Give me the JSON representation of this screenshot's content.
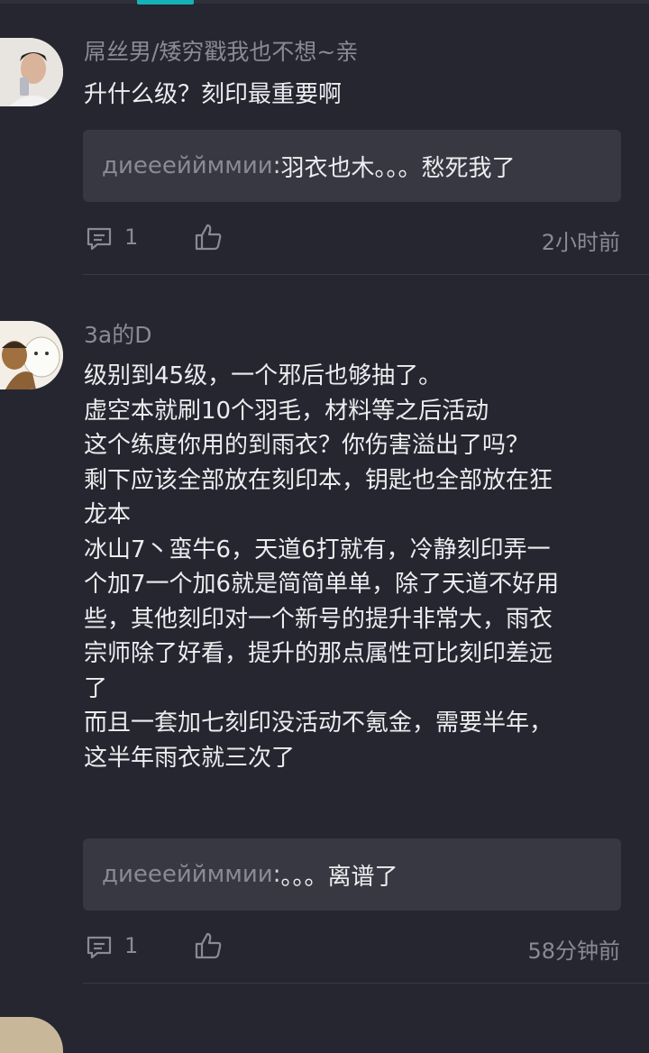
{
  "comments": [
    {
      "username": "屌丝男/矮穷戳我也不想~亲",
      "content": [
        "升什么级？刻印最重要啊"
      ],
      "reply": {
        "author": "диеееййммии",
        "separator": " : ",
        "text": "羽衣也木。。。愁死我了"
      },
      "reply_count": "1",
      "time": "2小时前"
    },
    {
      "username": "3a的D",
      "content": [
        "级别到45级，一个邪后也够抽了。",
        "虚空本就刷10个羽毛，材料等之后活动",
        "这个练度你用的到雨衣？你伤害溢出了吗？",
        "剩下应该全部放在刻印本，钥匙也全部放在狂",
        "龙本",
        "冰山7丶蛮牛6，天道6打就有，冷静刻印弄一",
        "个加7一个加6就是简简单单，除了天道不好用",
        "些，其他刻印对一个新号的提升非常大，雨衣",
        "宗师除了好看，提升的那点属性可比刻印差远",
        "了",
        "而且一套加七刻印没活动不氪金，需要半年，",
        "这半年雨衣就三次了"
      ],
      "reply": {
        "author": "диеееййммии",
        "separator": " : ",
        "text": "。。。离谱了"
      },
      "reply_count": "1",
      "time": "58分钟前"
    }
  ],
  "icons": {
    "comment": "comment-bubble-icon",
    "like": "thumbs-up-icon"
  },
  "colors": {
    "background": "#262630",
    "accent": "#15b3b7",
    "reply_box": "#383843"
  }
}
